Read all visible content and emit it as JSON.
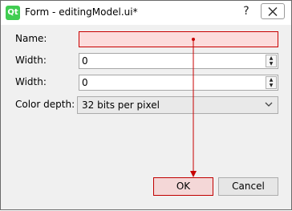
{
  "window": {
    "icon_text": "Qt",
    "title": "Form - editingModel.ui*",
    "help_label": "?"
  },
  "form": {
    "name_label": "Name:",
    "name_value": "",
    "width1_label": "Width:",
    "width1_value": "0",
    "width2_label": "Width:",
    "width2_value": "0",
    "color_label": "Color depth:",
    "color_value": "32 bits per pixel"
  },
  "buttons": {
    "ok_label": "OK",
    "cancel_label": "Cancel"
  },
  "colors": {
    "highlight": "#c80000",
    "qt_green": "#41cd52"
  }
}
